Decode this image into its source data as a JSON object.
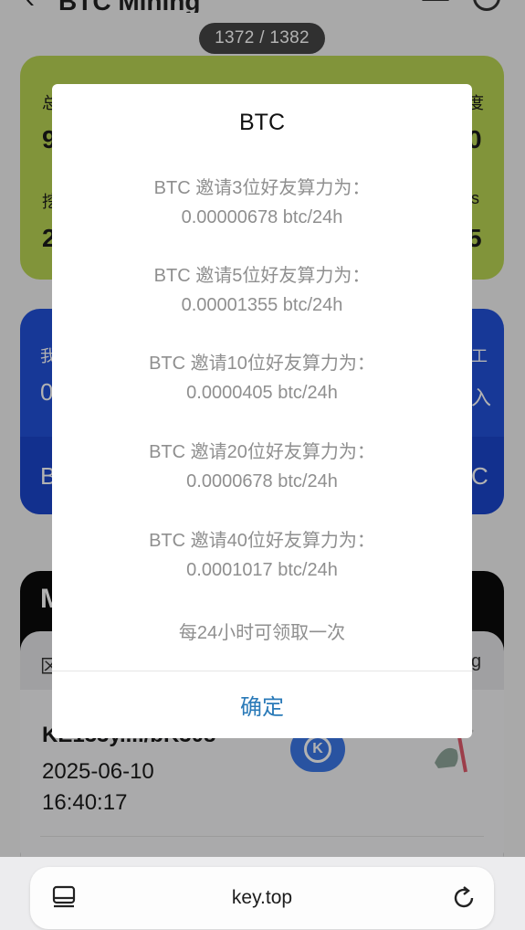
{
  "app": {
    "back_glyph": "‹",
    "title": "BTC Mining",
    "menu_icon": "menu-icon",
    "clock_icon": "clock-icon"
  },
  "image_counter": "1372 / 1382",
  "background": {
    "stats_card": {
      "left_top_label": "总",
      "left_top_value": "9",
      "left_bottom_label": "挖",
      "left_bottom_value": "2",
      "right_top_label": "度",
      "right_top_value": "0",
      "right_bottom_label": "s",
      "right_bottom_value": "5"
    },
    "invite_card": {
      "left_label": "我",
      "left_value": "0",
      "left_bottom": "B",
      "right_label": "工",
      "right_value": "入",
      "right_bottom": "C"
    },
    "mining_card": {
      "title": "M",
      "tab_left": "区",
      "tab_right": "g",
      "record": {
        "address": "KE133y..../bK308",
        "date": "2025-06-10",
        "time": "16:40:17"
      }
    }
  },
  "modal": {
    "title": "BTC",
    "tiers": [
      {
        "line1": "BTC 邀请3位好友算力为：",
        "line2": "0.00000678 btc/24h"
      },
      {
        "line1": "BTC 邀请5位好友算力为：",
        "line2": "0.00001355 btc/24h"
      },
      {
        "line1": "BTC 邀请10位好友算力为：",
        "line2": "0.0000405 btc/24h"
      },
      {
        "line1": "BTC 邀请20位好友算力为：",
        "line2": "0.0000678 btc/24h"
      },
      {
        "line1": "BTC 邀请40位好友算力为：",
        "line2": "0.0001017 btc/24h"
      }
    ],
    "note": "每24小时可领取一次",
    "confirm_label": "确定"
  },
  "browser": {
    "url": "key.top",
    "tabs_icon": "tabs-icon",
    "reload_icon": "reload-icon"
  },
  "colors": {
    "stats_card": "#b9d454",
    "invite_card": "#2251d9",
    "confirm_text": "#2a7ab8"
  }
}
